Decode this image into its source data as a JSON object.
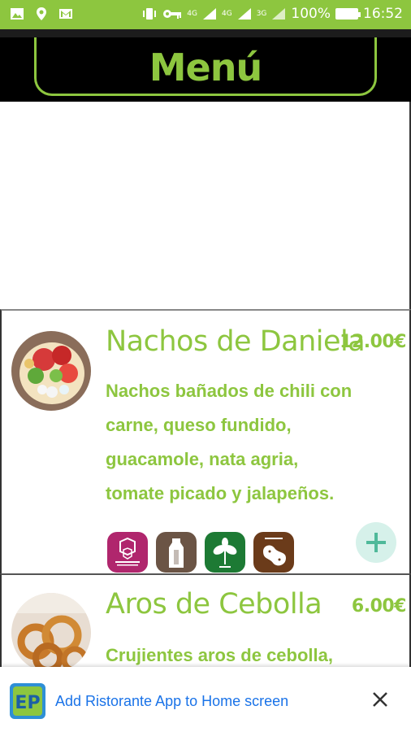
{
  "status_bar": {
    "left_icons": [
      "image-icon",
      "location-icon",
      "gmail-icon"
    ],
    "vibrate_icon": "vibrate-icon",
    "key_icon": "key-icon",
    "signal1_label": "4G",
    "signal2_label": "4G",
    "signal3_label": "3G",
    "battery_percent": "100%",
    "time": "16:52"
  },
  "header": {
    "title": "Menú",
    "accent_color": "#8dc63f",
    "background_color": "#000000"
  },
  "items": [
    {
      "name": "Nachos de Daniela",
      "price": "12.00€",
      "description": "Nachos bañados de chili con carne, queso fundido, guacamole, nata agria, tomate picado y jalapeños.",
      "allergens": [
        {
          "icon": "sulfites-icon",
          "label": "ANHIDRIDO SOLFOROSO",
          "color": "#b0266d"
        },
        {
          "icon": "milk-icon",
          "label": "LATTE",
          "color": "#6b5445"
        },
        {
          "icon": "soy-icon",
          "label": "SOIA",
          "color": "#1d7a34"
        },
        {
          "icon": "peanut-icon",
          "label": "ARACHIDI",
          "color": "#6b3b1a"
        }
      ]
    },
    {
      "name": "Aros de Cebolla",
      "price": "6.00€",
      "description": "Crujientes aros de cebolla,"
    }
  ],
  "install_banner": {
    "text": "Add Ristorante App to Home screen",
    "logo_icon": "app-logo-icon",
    "close_icon": "close-icon"
  }
}
